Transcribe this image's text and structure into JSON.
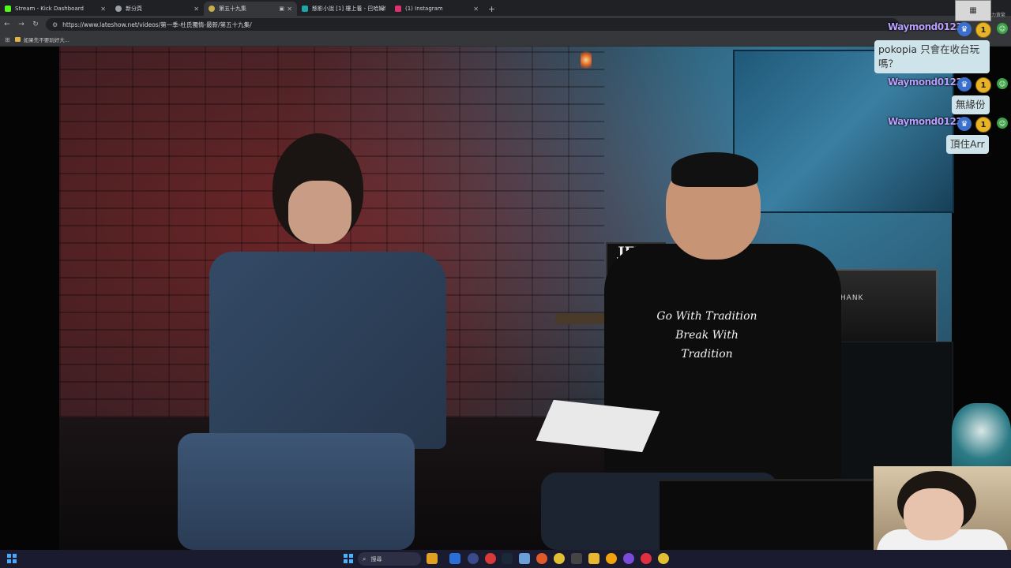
{
  "browser": {
    "tabs": [
      {
        "label": "Stream - Kick Dashboard",
        "color": "#53fc18",
        "active": false
      },
      {
        "label": "新分頁",
        "color": "#9aa0a6",
        "active": false
      },
      {
        "label": "第五十九集",
        "color": "#c7b04a",
        "active": true
      },
      {
        "label": "態影小說 [1] 樓上養 - 巴哈姆特",
        "color": "#1ea6a6",
        "active": false
      },
      {
        "label": "(1) Instagram",
        "color": "#e1306c",
        "active": false
      }
    ],
    "new_tab": "+",
    "url": "https://www.lateshow.net/videos/第一季-杜氏獨情-最新/第五十九集/",
    "bookmark": "如果先不要玩好大..."
  },
  "video": {
    "sign_text": "JEFF BECK",
    "shirt_line1": "Go With Tradition",
    "shirt_line2": "Break With Tradition",
    "amp_label": "KHANK"
  },
  "chat": {
    "messages": [
      {
        "user": "Waymond01234",
        "text": "pokopia 只會在收台玩嗎？"
      },
      {
        "user": "Waymond01234",
        "text": "無緣份"
      },
      {
        "user": "Waymond01234",
        "text": "頂住Arr"
      }
    ],
    "badge_number": "1",
    "topline_text": "力黃繁"
  },
  "taskbar": {
    "search_placeholder": "搜尋",
    "icons": [
      "weather-icon",
      "file-explorer-icon",
      "steam-icon",
      "chrome-icon",
      "obs-icon",
      "discord-icon",
      "edge-icon",
      "email-icon",
      "firefox-icon",
      "chrome-alt-icon",
      "obs-alt-icon",
      "folder-icon",
      "bitcoin-icon",
      "twitch-icon",
      "record-icon",
      "chrome-third-icon"
    ]
  }
}
